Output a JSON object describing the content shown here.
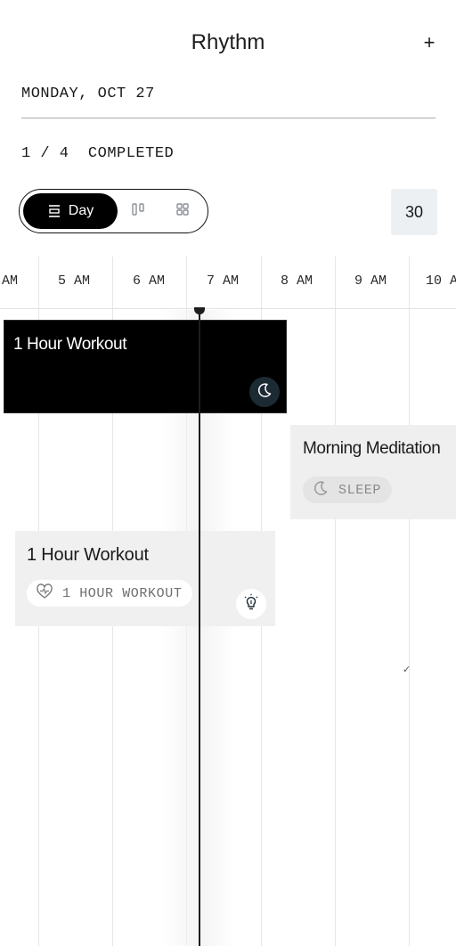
{
  "header": {
    "title": "Rhythm",
    "add_label": "+"
  },
  "date": "MONDAY, OCT 27",
  "progress": {
    "label": "1 / 4  COMPLETED",
    "done": 1,
    "total": 4
  },
  "view_switcher": {
    "selected": "Day",
    "options": [
      {
        "label": "Day",
        "icon": "list-view-icon"
      },
      {
        "label": "",
        "icon": "columns-view-icon"
      },
      {
        "label": "",
        "icon": "grid-view-icon"
      }
    ]
  },
  "zoom": {
    "value": "30"
  },
  "timeline": {
    "hours": [
      "AM",
      "5 AM",
      "6 AM",
      "7 AM",
      "8 AM",
      "9 AM",
      "10 AM"
    ],
    "current_time_marker": "now-indicator"
  },
  "events": [
    {
      "title": "1 Hour Workout",
      "icon": "moon-icon",
      "style": "dark"
    },
    {
      "title": "Morning Meditation",
      "tag": "SLEEP",
      "tag_icon": "moon-icon",
      "style": "light"
    },
    {
      "title": "1 Hour Workout",
      "tag": "1 HOUR WORKOUT",
      "tag_icon": "heart-pulse-icon",
      "icon": "lightbulb-icon",
      "style": "light"
    }
  ],
  "marks": {
    "check": "✓"
  },
  "colors": {
    "accent": "#000000",
    "zoom_bg": "#ecf0f3",
    "dark_icon_bg": "#1c2a33",
    "event_light_bg": "#efefef"
  }
}
